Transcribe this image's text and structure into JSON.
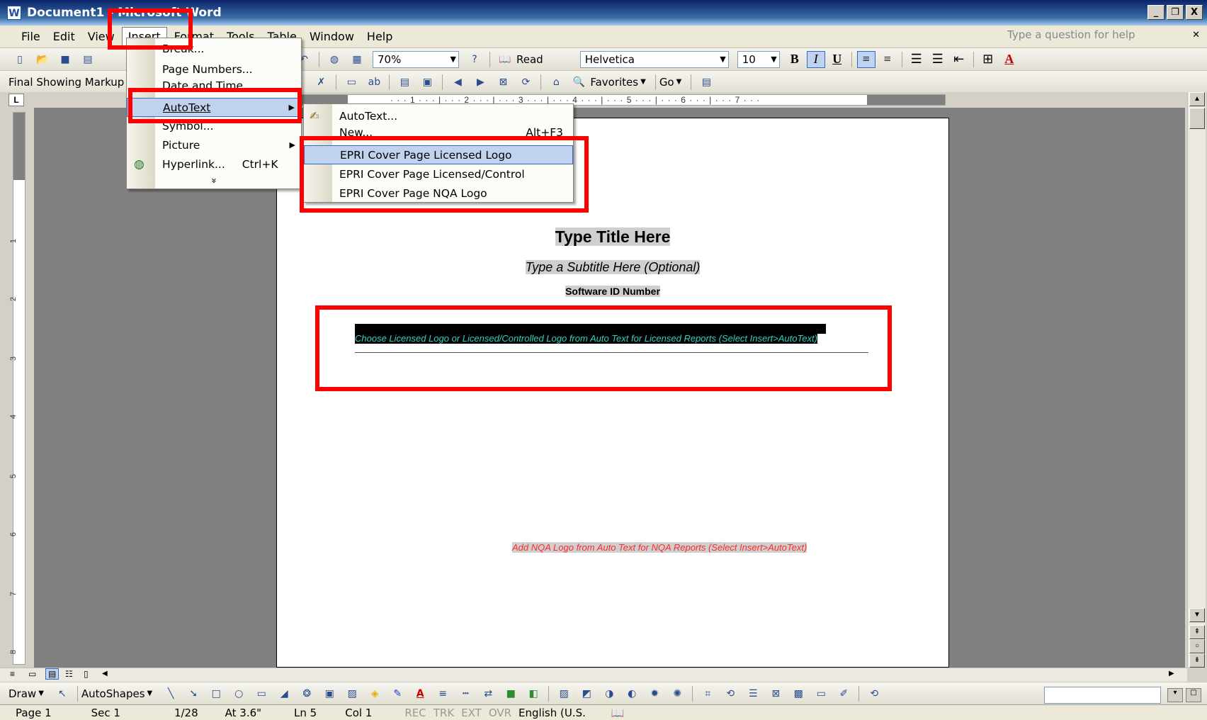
{
  "window": {
    "title": "Document1 - Microsoft Word",
    "controls": [
      "_",
      "❐",
      "X"
    ]
  },
  "menubar": {
    "items": [
      "File",
      "Edit",
      "View",
      "Insert",
      "Format",
      "Tools",
      "Table",
      "Window",
      "Help"
    ],
    "help_placeholder": "Type a question for help"
  },
  "standard_toolbar": {
    "zoom": "70%",
    "read_label": "Read",
    "font": "Helvetica",
    "font_size": "10"
  },
  "reviewing_toolbar": {
    "display_for_review": "Final Showing Markup",
    "favorites_label": "Favorites",
    "go_label": "Go"
  },
  "ruler": {
    "text": "· · · 1 · · · | · · · 2 · · · | · · · 3 · · · | · · · 4 · · · | · · · 5 · · · | · · · 6 · · · | · · · 7 · · ·"
  },
  "vruler_numbers": [
    "1",
    "2",
    "3",
    "4",
    "5",
    "6",
    "7",
    "8"
  ],
  "insert_menu": {
    "items": [
      {
        "label": "Break...",
        "shortcut": "",
        "submenu": false
      },
      {
        "label": "Page Numbers...",
        "shortcut": "",
        "submenu": false
      },
      {
        "label": "Date and Time...",
        "shortcut": "",
        "submenu": false
      },
      {
        "label": "AutoText",
        "shortcut": "",
        "submenu": true
      },
      {
        "label": "Symbol...",
        "shortcut": "",
        "submenu": false
      },
      {
        "label": "Picture",
        "shortcut": "",
        "submenu": true
      },
      {
        "label": "Hyperlink...",
        "shortcut": "Ctrl+K",
        "submenu": false
      }
    ],
    "expand_glyph": "»"
  },
  "autotext_submenu": {
    "items": [
      {
        "label": "AutoText...",
        "shortcut": ""
      },
      {
        "label": "New...",
        "shortcut": "Alt+F3"
      },
      {
        "label": "EPRI Cover Page Licensed Logo",
        "shortcut": ""
      },
      {
        "label": "EPRI Cover Page Licensed/Control",
        "shortcut": ""
      },
      {
        "label": "EPRI Cover Page NQA Logo",
        "shortcut": ""
      }
    ]
  },
  "document": {
    "title": "Type Title Here",
    "subtitle": "Type a Subtitle Here (Optional)",
    "software_id": "Software ID Number",
    "licensed_logo_instruction": "Choose Licensed Logo or Licensed/Controlled Logo from Auto Text for Licensed Reports (Select Insert>AutoText)",
    "nqa_instruction": "Add NQA Logo from Auto Text for NQA Reports (Select Insert>AutoText)"
  },
  "drawing_toolbar": {
    "draw_label": "Draw",
    "autoshapes_label": "AutoShapes"
  },
  "statusbar": {
    "page": "Page 1",
    "section": "Sec 1",
    "page_count": "1/28",
    "at": "At 3.6\"",
    "line": "Ln 5",
    "col": "Col 1",
    "rec": "REC",
    "trk": "TRK",
    "ext": "EXT",
    "ovr": "OVR",
    "language": "English (U.S."
  },
  "colors": {
    "highlight_red": "#ff0000",
    "menu_selection": "#c1d2ee",
    "accent": "#316ac5"
  }
}
